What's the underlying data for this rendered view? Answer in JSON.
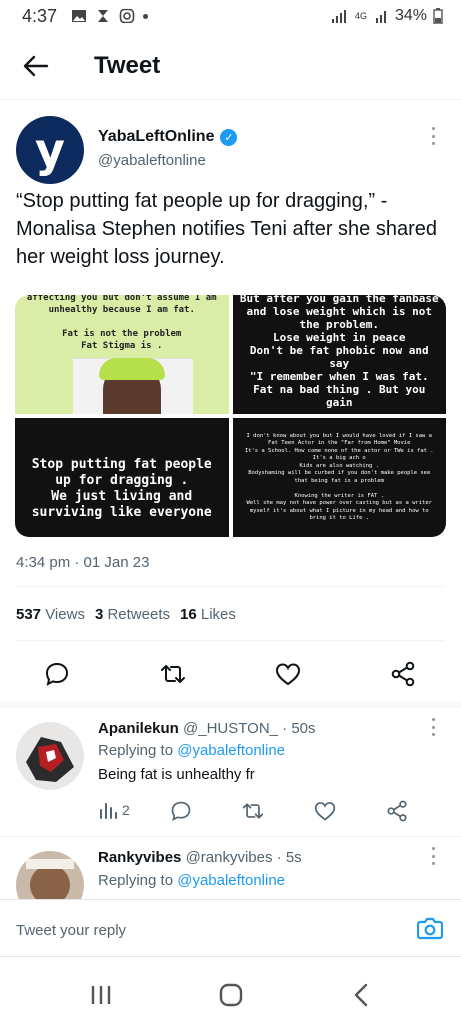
{
  "status_bar": {
    "time": "4:37",
    "battery": "34%",
    "network": "4G"
  },
  "header": {
    "title": "Tweet"
  },
  "tweet": {
    "display_name": "YabaLeftOnline",
    "handle": "@yabaleftonline",
    "avatar_letter": "y",
    "text": "“Stop putting fat people up for dragging,” - Monalisa Stephen notifies Teni after she shared her weight loss journey.",
    "images": [
      {
        "text": "affecting you but don't assume I am unhealthy because I am fat.\n\nFat is not the problem\nFat Stigma is ."
      },
      {
        "text": "But after you gain the fanbase and lose weight which is not the problem.\nLose weight in peace\nDon't be fat phobic now and say\n\"I remember when I was fat. Fat na bad thing . But you gain"
      },
      {
        "text": "Stop putting fat people up for dragging .\nWe just living and surviving like everyone"
      },
      {
        "text": "I don't know about you but I would have loved if I saw a Fat Teen Actor in the \"Far from Home\" Movie\nIt's a School. How come none of the actor or TWe is fat .\nIt's a big ach o\nKids are also watching .\nBodyshaming will be curbed if you don't make people see that being fat is a problem\n\nKnowing the writer is FAT .\nWell she may not have power over casting but as a writer myself it's about what I picture in my head and how to bring it to Life ."
      }
    ],
    "timestamp": "4:34 pm · 01 Jan 23",
    "stats": {
      "views_count": "537",
      "views_label": "Views",
      "retweets_count": "3",
      "retweets_label": "Retweets",
      "likes_count": "16",
      "likes_label": "Likes"
    }
  },
  "replies": [
    {
      "name": "Apanilekun",
      "meta": "@_HUSTON_ · 50s",
      "replying_prefix": "Replying to",
      "replying_to": "@yabaleftonline",
      "text": "Being fat is unhealthy fr",
      "views": "2"
    },
    {
      "name": "Rankyvibes",
      "meta": "@rankyvibes · 5s",
      "replying_prefix": "Replying to",
      "replying_to": "@yabaleftonline"
    }
  ],
  "composer": {
    "placeholder": "Tweet your reply"
  },
  "colors": {
    "accent": "#1d9bf0",
    "text": "#0f1419",
    "secondary": "#536471"
  },
  "icons": [
    "back-arrow-icon",
    "verified-badge-icon",
    "more-icon",
    "reply-icon",
    "retweet-icon",
    "like-icon",
    "share-icon",
    "views-icon",
    "camera-icon",
    "recents-icon",
    "home-icon",
    "nav-back-icon"
  ]
}
